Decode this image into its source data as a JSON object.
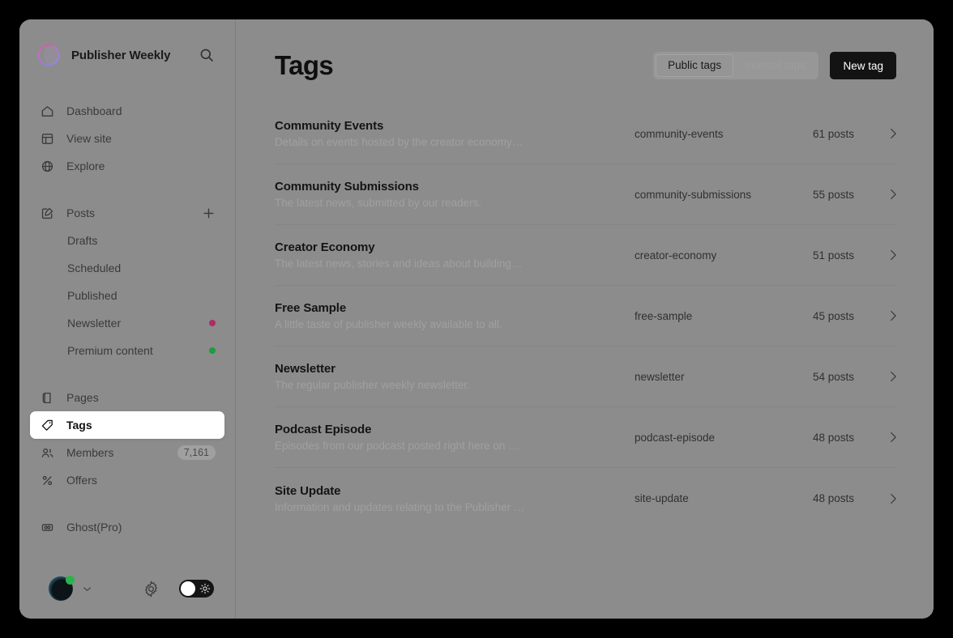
{
  "sidebar": {
    "brand": {
      "title": "Publisher Weekly",
      "logo_icon": "circle-gradient-logo",
      "search_icon": "search-icon"
    },
    "primary_items": [
      {
        "label": "Dashboard",
        "icon": "home-icon"
      },
      {
        "label": "View site",
        "icon": "layout-icon"
      },
      {
        "label": "Explore",
        "icon": "globe-icon"
      }
    ],
    "posts_group": {
      "header": {
        "label": "Posts",
        "icon": "edit-square-icon",
        "add_icon": "plus-icon"
      },
      "items": [
        {
          "label": "Drafts"
        },
        {
          "label": "Scheduled"
        },
        {
          "label": "Published"
        },
        {
          "label": "Newsletter",
          "dot_color": "#b02c66"
        },
        {
          "label": "Premium content",
          "dot_color": "#1f9c3c"
        }
      ]
    },
    "content_items": [
      {
        "label": "Pages",
        "icon": "pages-icon"
      },
      {
        "label": "Tags",
        "icon": "tag-icon",
        "active": true
      },
      {
        "label": "Members",
        "icon": "members-icon",
        "badge": "7,161"
      },
      {
        "label": "Offers",
        "icon": "percent-icon"
      }
    ],
    "footer_nav": [
      {
        "label": "Ghost(Pro)",
        "icon": "ghost-pro-icon"
      }
    ],
    "footer": {
      "avatar_icon": "avatar",
      "status_color": "#2cb34a",
      "chevron_icon": "chevron-down-icon",
      "settings_icon": "gear-icon",
      "theme_toggle_icon": "sun-icon"
    }
  },
  "header": {
    "title": "Tags",
    "tabs": [
      {
        "label": "Public tags",
        "selected": true
      },
      {
        "label": "Internal tags",
        "selected": false
      }
    ],
    "new_tag_label": "New tag"
  },
  "tags": [
    {
      "name": "Community Events",
      "description": "Details on events hosted by the creator economy…",
      "slug": "community-events",
      "posts": "61 posts"
    },
    {
      "name": "Community Submissions",
      "description": "The latest news, submitted by our readers.",
      "slug": "community-submissions",
      "posts": "55 posts"
    },
    {
      "name": "Creator Economy",
      "description": "The latest news, stories and ideas about building…",
      "slug": "creator-economy",
      "posts": "51 posts"
    },
    {
      "name": "Free Sample",
      "description": "A little taste of publisher weekly available to all.",
      "slug": "free-sample",
      "posts": "45 posts"
    },
    {
      "name": "Newsletter",
      "description": "The regular publisher weekly newsletter.",
      "slug": "newsletter",
      "posts": "54 posts"
    },
    {
      "name": "Podcast Episode",
      "description": "Episodes from our podcast posted right here on …",
      "slug": "podcast-episode",
      "posts": "48 posts"
    },
    {
      "name": "Site Update",
      "description": "Information and updates relating to the Publisher …",
      "slug": "site-update",
      "posts": "48 posts"
    }
  ],
  "colors": {
    "accent_pink": "#b02c66",
    "accent_green": "#1f9c3c",
    "button_dark": "#131313",
    "surface": "#8c8c8c"
  }
}
